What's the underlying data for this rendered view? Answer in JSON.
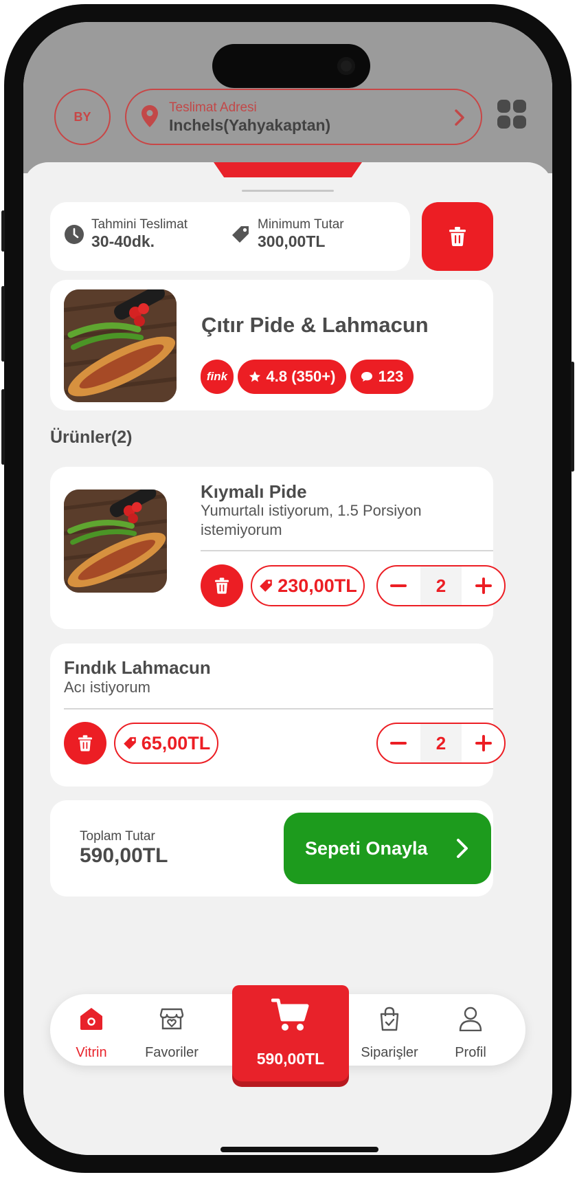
{
  "header": {
    "avatar_initials": "BY",
    "address_label": "Teslimat Adresi",
    "address_value": "Inchels(Yahyakaptan)"
  },
  "info": {
    "delivery_label": "Tahmini Teslimat",
    "delivery_value": "30-40dk.",
    "minimum_label": "Minimum Tutar",
    "minimum_value": "300,00TL"
  },
  "restaurant": {
    "name": "Çıtır Pide & Lahmacun",
    "brand_badge": "fink",
    "rating": "4.8 (350+)",
    "comments": "123"
  },
  "products_title": "Ürünler(2)",
  "items": [
    {
      "name": "Kıymalı Pide",
      "note_line1": "Yumurtalı istiyorum, 1.5 Porsiyon",
      "note_line2": "istemiyorum",
      "price": "230,00TL",
      "qty": "2"
    },
    {
      "name": "Fındık Lahmacun",
      "note_line1": "Acı istiyorum",
      "price": "65,00TL",
      "qty": "2"
    }
  ],
  "summary": {
    "total_label": "Toplam Tutar",
    "total_value": "590,00TL",
    "confirm_label": "Sepeti Onayla"
  },
  "nav": {
    "items": [
      {
        "label": "Vitrin",
        "icon": "store-home-icon",
        "active": true
      },
      {
        "label": "Favoriler",
        "icon": "favorite-store-icon",
        "active": false
      },
      {
        "label": "Siparişler",
        "icon": "orders-bag-icon",
        "active": false
      },
      {
        "label": "Profil",
        "icon": "profile-icon",
        "active": false
      }
    ],
    "cart_total": "590,00TL"
  },
  "colors": {
    "accent_red": "#ec1e24",
    "confirm_green": "#1d9b1d",
    "text_dark": "#4b4b4b",
    "background": "#f1f1f1"
  }
}
